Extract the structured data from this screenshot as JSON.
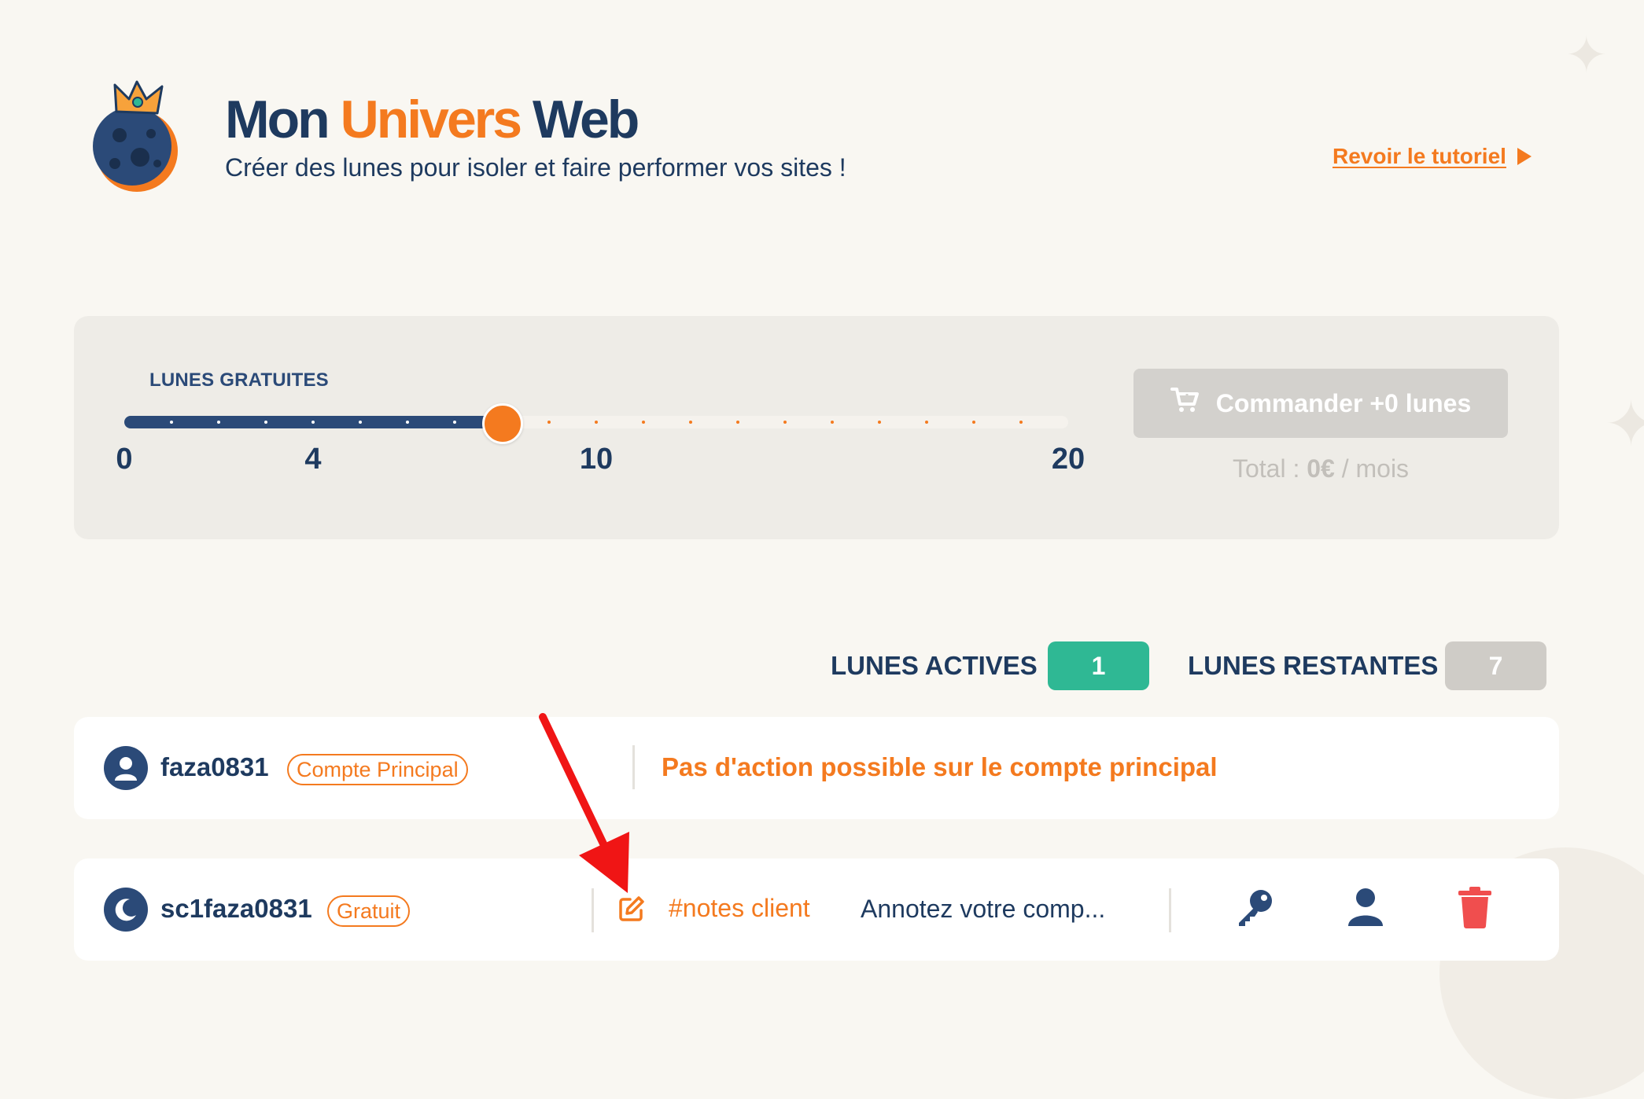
{
  "header": {
    "title_part1": "Mon",
    "title_part2": "Univers",
    "title_part3": "Web",
    "subtitle": "Créer des lunes pour isoler et faire performer vos sites !",
    "tutorial_link": "Revoir le tutoriel"
  },
  "slider": {
    "label": "LUNES GRATUITES",
    "scale": [
      "0",
      "4",
      "10",
      "20"
    ],
    "min": 0,
    "max": 20,
    "free_count": 8,
    "value": 8
  },
  "order": {
    "button_label": "Commander +0 lunes",
    "total_prefix": "Total :",
    "total_amount": "0€",
    "total_suffix": "/ mois"
  },
  "counters": {
    "active_label": "LUNES ACTIVES",
    "active_value": "1",
    "remaining_label": "LUNES RESTANTES",
    "remaining_value": "7"
  },
  "accounts": [
    {
      "name": "faza0831",
      "badge": "Compte Principal",
      "message": "Pas d'action possible sur le compte principal"
    },
    {
      "name": "sc1faza0831",
      "badge": "Gratuit",
      "note_tag": "#notes client",
      "note_placeholder": "Annotez votre comp..."
    }
  ],
  "colors": {
    "navy": "#1e3a5f",
    "orange": "#f47a1f",
    "green": "#2fb894",
    "grey": "#cfccc7",
    "red": "#f04e4e"
  }
}
